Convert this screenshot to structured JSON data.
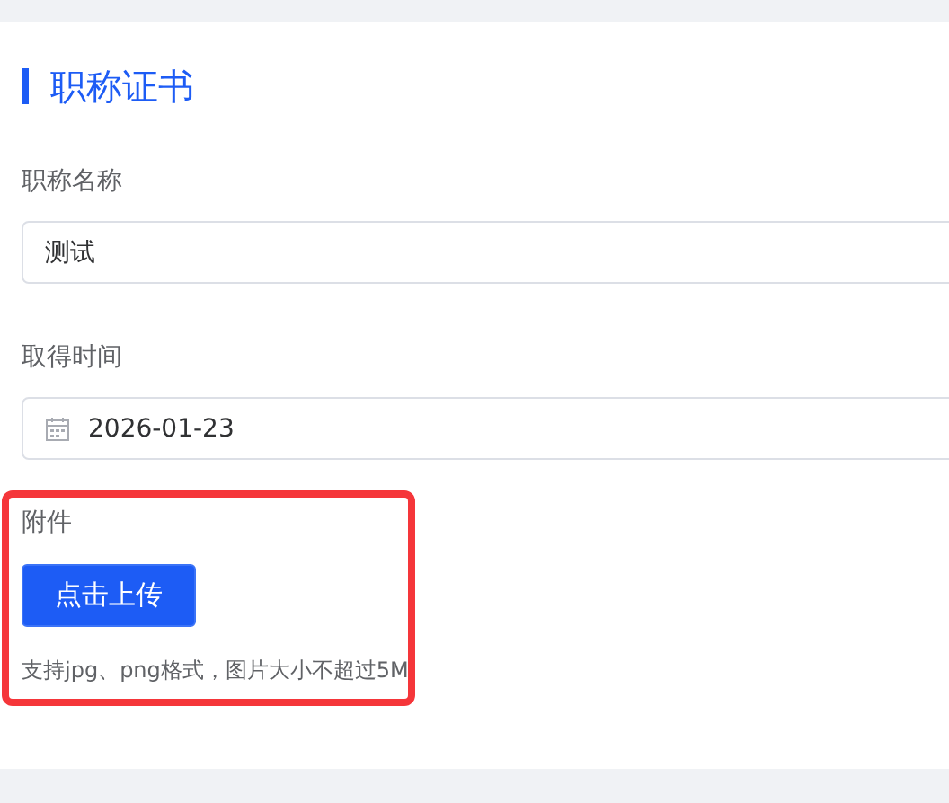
{
  "section": {
    "title": "职称证书"
  },
  "fields": [
    {
      "kind": "text",
      "label": "职称名称",
      "value": "测试"
    },
    {
      "kind": "date",
      "label": "取得时间",
      "value": "2026-01-23"
    }
  ],
  "attachment": {
    "label": "附件",
    "button": "点击上传",
    "hint": "支持jpg、png格式，图片大小不超过5M"
  }
}
